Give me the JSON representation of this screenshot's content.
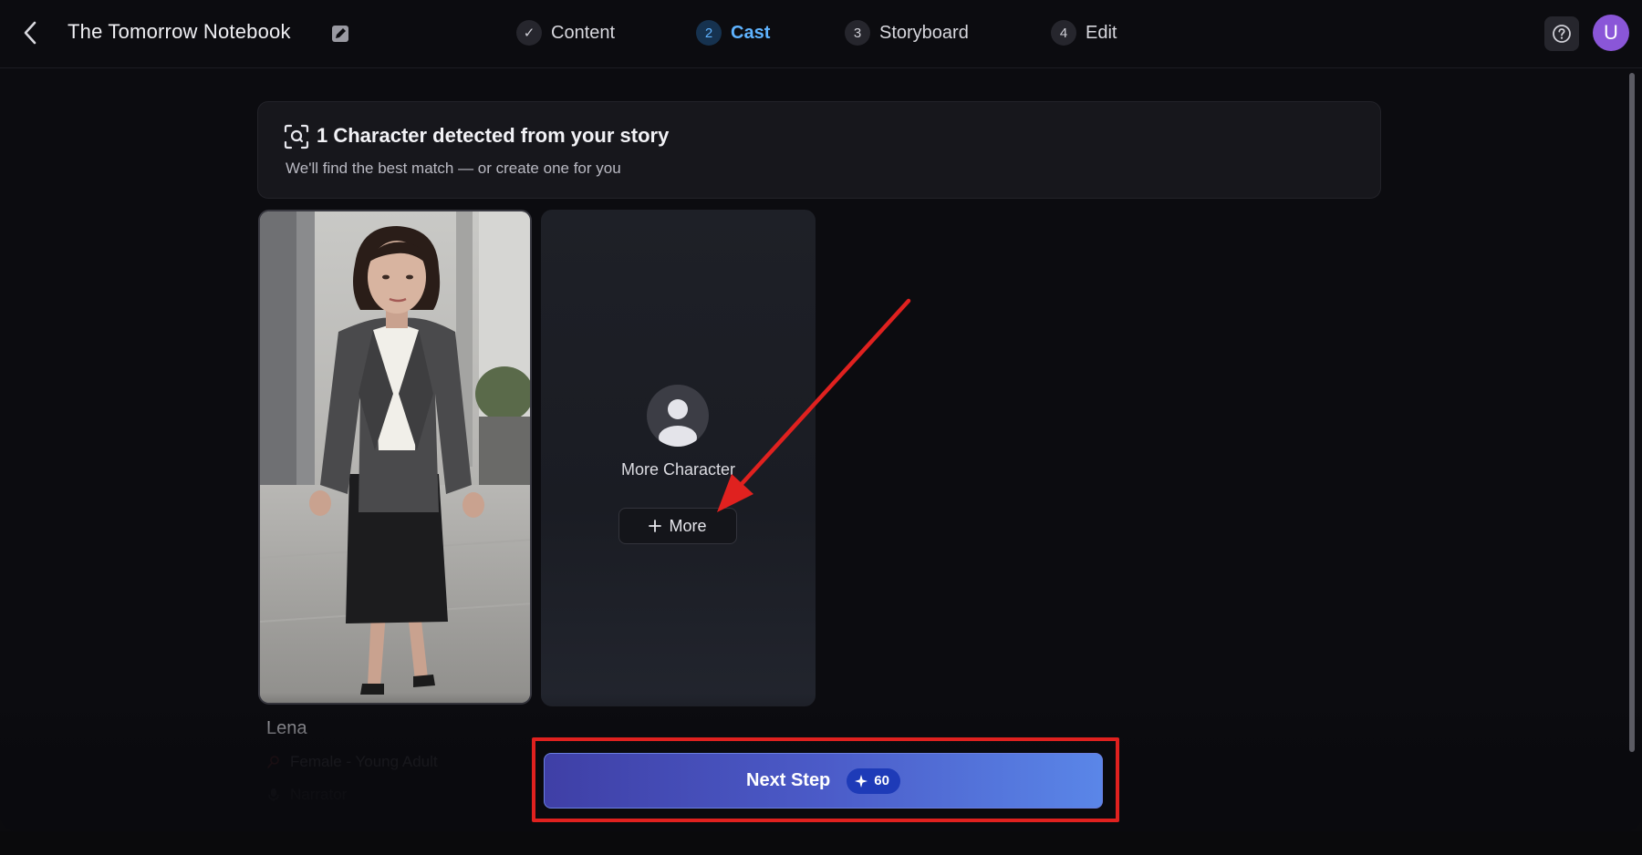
{
  "header": {
    "title": "The Tomorrow Notebook",
    "steps": [
      {
        "badge": "✓",
        "label": "Content",
        "state": "done"
      },
      {
        "badge": "2",
        "label": "Cast",
        "state": "active"
      },
      {
        "badge": "3",
        "label": "Storyboard",
        "state": "todo"
      },
      {
        "badge": "4",
        "label": "Edit",
        "state": "todo"
      }
    ],
    "avatar_initial": "U"
  },
  "banner": {
    "title": "1 Character detected from your story",
    "subtitle": "We'll find the best match — or create one for you"
  },
  "characters": [
    {
      "name": "Lena",
      "meta": "Female - Young Adult",
      "meta2": "Narrator"
    }
  ],
  "more_card": {
    "title": "More Character",
    "button_label": "More"
  },
  "footer": {
    "next_label": "Next Step",
    "credits": "60"
  },
  "colors": {
    "accent": "#5fb3ff",
    "avatar": "#8a56d8",
    "highlight": "#e0211f"
  }
}
